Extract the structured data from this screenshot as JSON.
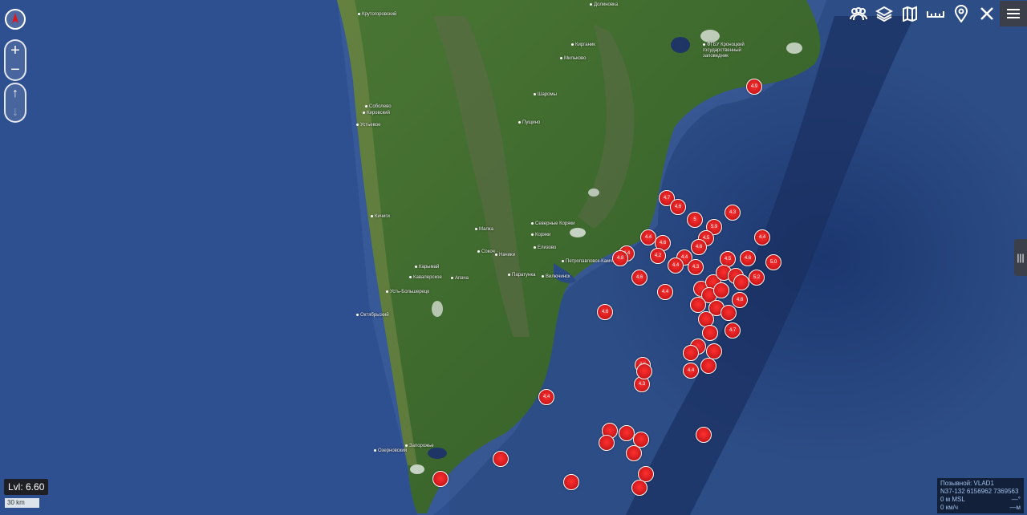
{
  "map": {
    "level_label": "Lvl: 6.60",
    "scale_label": "30 km",
    "colors": {
      "ocean": "#2d4d86",
      "land": "#3f6b2e",
      "marker": "#e0161c"
    },
    "place_labels": [
      "Крутогоровский",
      "Долиновка",
      "ФГБУ Кроноцкий государственный заповедник",
      "Мильково",
      "Шаромы",
      "Пущино",
      "Соболево",
      "Кировский",
      "Устьевое",
      "Кичиги",
      "Малка",
      "Северные Коряки",
      "Коряки",
      "Сокоч",
      "Начики",
      "Елизово",
      "Паратунка",
      "Петропавловск-Камчатский",
      "Вилючинск",
      "Карымай",
      "Кавалерское",
      "Апача",
      "Усть-Большерецк",
      "Октябрьский",
      "Озерновский",
      "Запорожье",
      "Кирганик"
    ],
    "quake_magnitudes": [
      "4.9",
      "4.7",
      "4.6",
      "4.3",
      "5",
      "5.9",
      "4.4",
      "4.6",
      "4.4",
      "4.5",
      "4.4",
      "4.8",
      "4.6",
      "4.2",
      "4.4",
      "5.0",
      "4.5",
      "4.6",
      "4.4",
      "4.3",
      "4.6",
      "5.2",
      "4.4",
      "4.6",
      "4.8",
      "4.7",
      "4.5",
      "4.4",
      "4.3",
      "4.4"
    ]
  },
  "toolbar": {
    "icons": [
      "users-icon",
      "layers-icon",
      "map-icon",
      "ruler-icon",
      "location-pin-icon",
      "close-icon",
      "menu-icon"
    ]
  },
  "status": {
    "callsign": "Позывной: VLAD1",
    "coords": "N37-132 6156962 7369563",
    "altitude": "0 м MSL",
    "altitude_unit": "—°",
    "speed": "0 км/ч",
    "speed_unit": "—м"
  }
}
